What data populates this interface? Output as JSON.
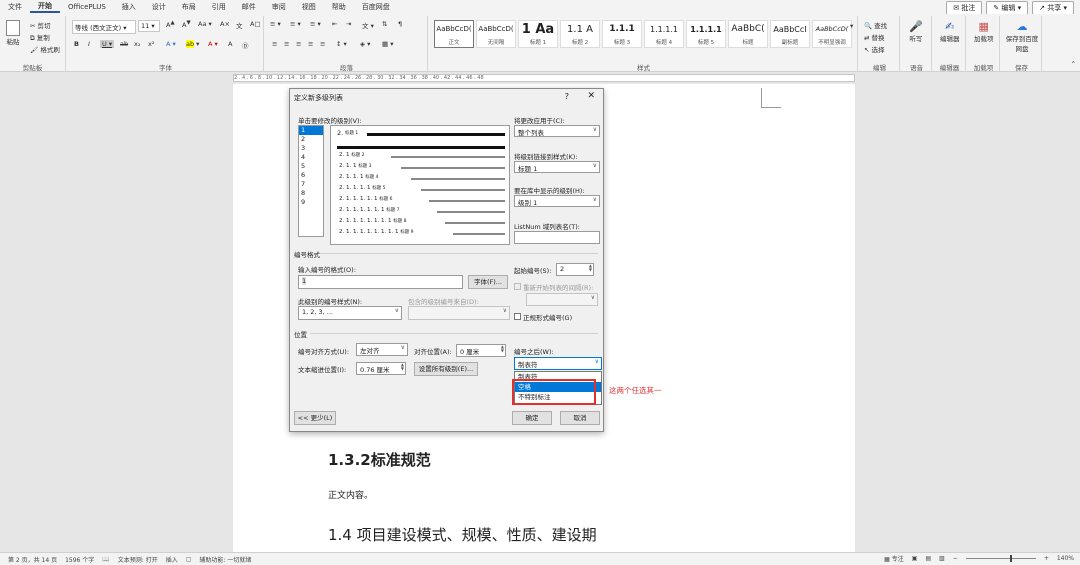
{
  "menu": {
    "tabs": [
      "文件",
      "开始",
      "OfficePLUS",
      "插入",
      "设计",
      "布局",
      "引用",
      "邮件",
      "审阅",
      "视图",
      "帮助",
      "百度网盘"
    ],
    "active": "开始",
    "comments_btn": "批注",
    "edit_btn": "编辑",
    "share_btn": "共享"
  },
  "ribbon": {
    "clipboard": {
      "paste": "粘贴",
      "cut": "剪切",
      "copy": "复制",
      "painter": "格式刷",
      "label": "剪贴板"
    },
    "font": {
      "name": "等线 (西文正文)",
      "size": "11",
      "label": "字体"
    },
    "paragraph": {
      "label": "段落"
    },
    "styles": {
      "label": "样式",
      "items": [
        {
          "sample": "AaBbCcD(",
          "name": "正文"
        },
        {
          "sample": "AaBbCcD(",
          "name": "无间隔"
        },
        {
          "sample": "1 Aa",
          "name": "标题 1"
        },
        {
          "sample": "1.1 A",
          "name": "标题 2"
        },
        {
          "sample": "1.1.1",
          "name": "标题 3"
        },
        {
          "sample": "1.1.1.1",
          "name": "标题 4"
        },
        {
          "sample": "1.1.1.1",
          "name": "标题 5"
        },
        {
          "sample": "AaBbC(",
          "name": "标题"
        },
        {
          "sample": "AaBbCcI",
          "name": "副标题"
        },
        {
          "sample": "AaBbCcD(",
          "name": "不明显强调"
        }
      ]
    },
    "editing": {
      "find": "查找",
      "replace": "替换",
      "select": "选择",
      "label": "编辑"
    },
    "voice": {
      "dictate": "听写",
      "label": "语音"
    },
    "editor": {
      "name": "编辑器",
      "label": "编辑器"
    },
    "addins": {
      "name": "加载项",
      "label": "加载项"
    },
    "save": {
      "name": "保存到百度网盘",
      "label": "保存"
    }
  },
  "ruler": "2 . 4 . 6 . 8 . 10 . 12 . 14 . 16 . 18 . 20 . 22 . 24 . 26 . 28 . 30 . 32 . 34 . 36 . 38 . 40 . 42 . 44 . 46 . 48",
  "document": {
    "heading1": "1.3.2标准规范",
    "body": "正文内容。",
    "heading2": "1.4  项目建设模式、规模、性质、建设期"
  },
  "dialog": {
    "title": "定义新多级列表",
    "help": "?",
    "close": "✕",
    "level_label": "单击要修改的级别(V):",
    "levels": [
      "1",
      "2",
      "3",
      "4",
      "5",
      "6",
      "7",
      "8",
      "9"
    ],
    "selected_level": "1",
    "preview_rows": [
      {
        "num": "2.",
        "tag": "标题 1"
      },
      {
        "num": "2. 1",
        "tag": "标题 2"
      },
      {
        "num": "2. 1. 1",
        "tag": "标题 3"
      },
      {
        "num": "2. 1. 1. 1",
        "tag": "标题 4"
      },
      {
        "num": "2. 1. 1. 1. 1",
        "tag": "标题 5"
      },
      {
        "num": "2. 1. 1. 1. 1. 1",
        "tag": "标题 6"
      },
      {
        "num": "2. 1. 1. 1. 1. 1. 1",
        "tag": "标题 7"
      },
      {
        "num": "2. 1. 1. 1. 1. 1. 1. 1",
        "tag": "标题 8"
      },
      {
        "num": "2. 1. 1. 1. 1. 1. 1. 1. 1",
        "tag": "标题 9"
      }
    ],
    "apply_to_label": "将更改应用于(C):",
    "apply_to_value": "整个列表",
    "link_style_label": "将级别链接到样式(K):",
    "link_style_value": "标题 1",
    "gallery_level_label": "要在库中显示的级别(H):",
    "gallery_level_value": "级别 1",
    "listnum_label": "ListNum 域列表名(T):",
    "listnum_value": "",
    "number_format_section": "编号格式",
    "enter_format_label": "输入编号的格式(O):",
    "enter_format_value": "1",
    "font_btn": "字体(F)...",
    "start_at_label": "起始编号(S):",
    "start_at_value": "2",
    "restart_label": "重新开始列表的间隔(R):",
    "style_for_level_label": "此级别的编号样式(N):",
    "style_for_level_value": "1, 2, 3, ...",
    "include_level_label": "包含的级别编号来自(D):",
    "legal_label": "正规形式编号(G)",
    "position_section": "位置",
    "alignment_label": "编号对齐方式(U):",
    "alignment_value": "左对齐",
    "aligned_at_label": "对齐位置(A):",
    "aligned_at_value": "0 厘米",
    "indent_label": "文本缩进位置(I):",
    "indent_value": "0.76 厘米",
    "set_all_btn": "设置所有级别(E)...",
    "follow_label": "编号之后(W):",
    "follow_value": "制表符",
    "follow_options": [
      "制表符",
      "空格",
      "不特别标注"
    ],
    "follow_highlighted": "空格",
    "less_btn": "<< 更少(L)",
    "ok_btn": "确定",
    "cancel_btn": "取消"
  },
  "annotation": "这两个任选其一",
  "status": {
    "page": "第 2 页，共 14 页",
    "words": "1596 个字",
    "predict": "文本预测: 打开",
    "insert": "插入",
    "accessibility": "辅助功能: 一切就绪",
    "focus": "专注",
    "zoom": "140%"
  },
  "colors": {
    "accent": "#2b579a",
    "highlight": "#0078d7",
    "annotation": "#e03030"
  }
}
